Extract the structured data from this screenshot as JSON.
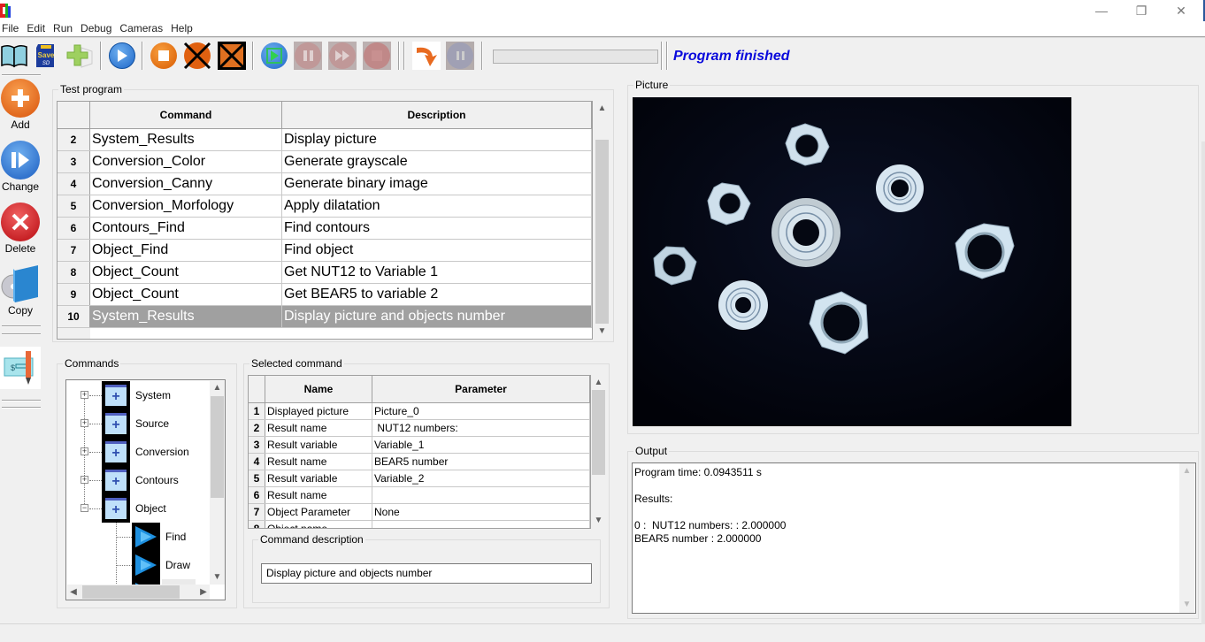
{
  "window": {
    "controls": {
      "minimize": "—",
      "restore": "❐",
      "close": "✕"
    }
  },
  "menu": [
    "File",
    "Edit",
    "Run",
    "Debug",
    "Cameras",
    "Help"
  ],
  "toolbar": {
    "buttons": [
      {
        "name": "open-book",
        "icon": "book-icon",
        "enabled": true
      },
      {
        "name": "save",
        "icon": "save-sd-card-icon",
        "label": "Save",
        "enabled": true
      },
      {
        "name": "add-new",
        "icon": "green-plus-icon",
        "enabled": true
      },
      {
        "name": "run",
        "icon": "play-icon",
        "enabled": true
      },
      {
        "name": "stop",
        "icon": "stop-icon",
        "enabled": true
      },
      {
        "name": "stop-disabled-x",
        "icon": "stop-crossed-icon",
        "enabled": true
      },
      {
        "name": "stop-all-x",
        "icon": "stop-box-crossed-icon",
        "enabled": true
      },
      {
        "name": "debug-run",
        "icon": "debug-play-icon",
        "enabled": true
      },
      {
        "name": "pause",
        "icon": "pause-icon",
        "enabled": false
      },
      {
        "name": "step",
        "icon": "fast-forward-icon",
        "enabled": false
      },
      {
        "name": "debug-stop",
        "icon": "stop-icon",
        "enabled": false
      },
      {
        "name": "step-over",
        "icon": "curved-arrow-icon",
        "enabled": true
      },
      {
        "name": "pause-2",
        "icon": "pause-icon",
        "enabled": false
      }
    ],
    "progress": 0,
    "status": "Program finished",
    "status_color": "#0a0adc"
  },
  "sidebar": {
    "buttons": [
      {
        "label": "Add",
        "icon": "add-icon"
      },
      {
        "label": "Change",
        "icon": "change-icon"
      },
      {
        "label": "Delete",
        "icon": "delete-icon"
      },
      {
        "label": "Copy",
        "icon": "copy-icon"
      }
    ],
    "extra_icon": "check-pen-icon"
  },
  "test_program": {
    "title": "Test program",
    "columns": [
      "Command",
      "Description"
    ],
    "rows": [
      {
        "n": "2",
        "command": "System_Results",
        "description": "Display picture"
      },
      {
        "n": "3",
        "command": "Conversion_Color",
        "description": "Generate grayscale"
      },
      {
        "n": "4",
        "command": "Conversion_Canny",
        "description": "Generate binary image"
      },
      {
        "n": "5",
        "command": "Conversion_Morfology",
        "description": "Apply dilatation"
      },
      {
        "n": "6",
        "command": "Contours_Find",
        "description": "Find contours"
      },
      {
        "n": "7",
        "command": "Object_Find",
        "description": "Find object"
      },
      {
        "n": "8",
        "command": "Object_Count",
        "description": "Get NUT12 to Variable 1"
      },
      {
        "n": "9",
        "command": "Object_Count",
        "description": "Get BEAR5 to variable 2"
      },
      {
        "n": "10",
        "command": "System_Results",
        "description": "Display picture and objects number",
        "selected": true
      }
    ]
  },
  "commands": {
    "title": "Commands",
    "tree": [
      {
        "label": "System",
        "expanded": false
      },
      {
        "label": "Source",
        "expanded": false
      },
      {
        "label": "Conversion",
        "expanded": false
      },
      {
        "label": "Contours",
        "expanded": false
      },
      {
        "label": "Object",
        "expanded": true,
        "children": [
          "Find",
          "Draw"
        ]
      }
    ]
  },
  "selected_command": {
    "title": "Selected command",
    "columns": [
      "Name",
      "Parameter"
    ],
    "rows": [
      {
        "n": "1",
        "name": "Displayed picture",
        "param": "Picture_0"
      },
      {
        "n": "2",
        "name": "Result name",
        "param": " NUT12 numbers:"
      },
      {
        "n": "3",
        "name": "Result variable",
        "param": "Variable_1"
      },
      {
        "n": "4",
        "name": "Result name",
        "param": "BEAR5 number"
      },
      {
        "n": "5",
        "name": "Result variable",
        "param": "Variable_2"
      },
      {
        "n": "6",
        "name": "Result name",
        "param": ""
      },
      {
        "n": "7",
        "name": "Object Parameter",
        "param": "None"
      },
      {
        "n": "8",
        "name": "Object name",
        "param": ""
      }
    ],
    "description_title": "Command description",
    "description": "Display picture and objects number"
  },
  "picture": {
    "title": "Picture",
    "content": "camera image of nuts and bearings on black background"
  },
  "output": {
    "title": "Output",
    "text": "Program time: 0.0943511 s\n\nResults:\n\n0 :  NUT12 numbers: : 2.000000\nBEAR5 number : 2.000000"
  }
}
